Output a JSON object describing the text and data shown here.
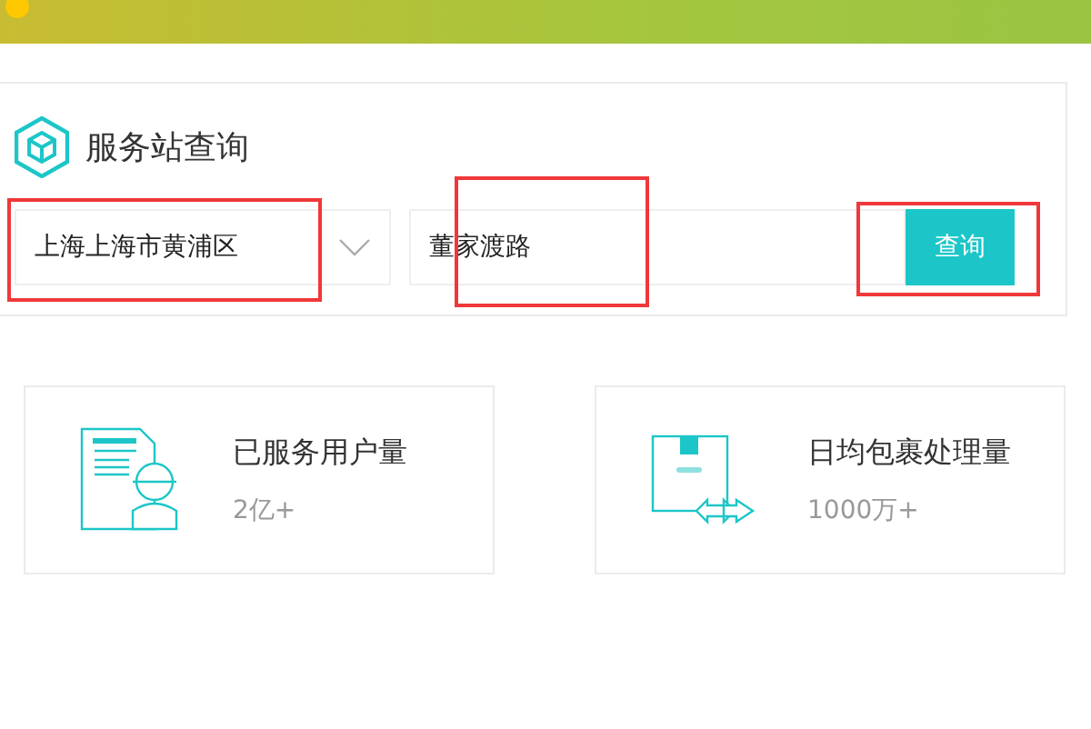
{
  "panel": {
    "title": "服务站查询",
    "region_select": {
      "value": "上海上海市黄浦区",
      "highlighted": true
    },
    "address_field": {
      "value": "董家渡路",
      "highlighted": true
    },
    "search_button": {
      "label": "查询",
      "highlighted": true
    }
  },
  "stats": [
    {
      "kind": "users",
      "label": "已服务用户量",
      "value": "2亿+"
    },
    {
      "kind": "parcels",
      "label": "日均包裹处理量",
      "value": "1000万+"
    }
  ]
}
